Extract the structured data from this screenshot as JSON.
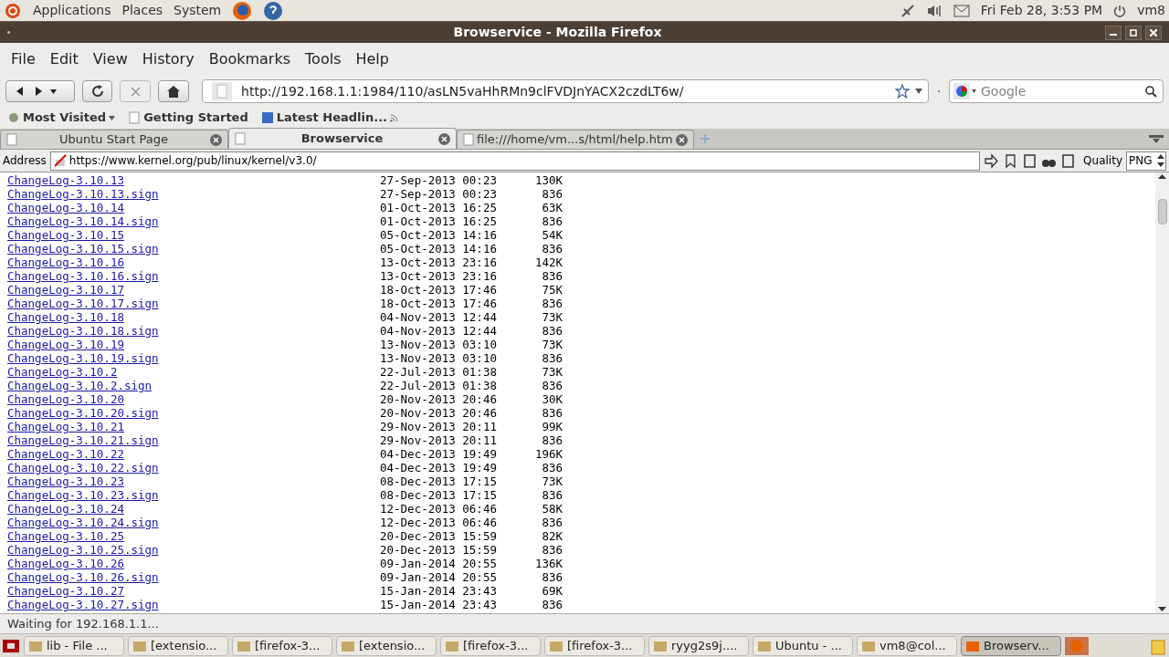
{
  "top_panel": {
    "menus": [
      "Applications",
      "Places",
      "System"
    ],
    "clock": "Fri Feb 28,  3:53 PM",
    "user": "vm8"
  },
  "window": {
    "title": "Browservice - Mozilla Firefox"
  },
  "menu_bar": [
    "File",
    "Edit",
    "View",
    "History",
    "Bookmarks",
    "Tools",
    "Help"
  ],
  "url": "http://192.168.1.1:1984/110/asLN5vaHhRMn9clFVDJnYACX2czdLT6w/",
  "search": {
    "placeholder": "Google"
  },
  "bookmarks": [
    "Most Visited",
    "Getting Started",
    "Latest Headlin..."
  ],
  "tabs": [
    {
      "label": "Ubuntu Start Page",
      "selected": false
    },
    {
      "label": "Browservice",
      "selected": true
    },
    {
      "label": "file:///home/vm...s/html/help.htm",
      "selected": false
    }
  ],
  "inner_toolbar": {
    "address_label": "Address",
    "address": "https://www.kernel.org/pub/linux/kernel/v3.0/",
    "quality_label": "Quality",
    "quality": "PNG"
  },
  "listing": [
    [
      "ChangeLog-3.10.13",
      "27-Sep-2013 00:23",
      "130K"
    ],
    [
      "ChangeLog-3.10.13.sign",
      "27-Sep-2013 00:23",
      "836"
    ],
    [
      "ChangeLog-3.10.14",
      "01-Oct-2013 16:25",
      "63K"
    ],
    [
      "ChangeLog-3.10.14.sign",
      "01-Oct-2013 16:25",
      "836"
    ],
    [
      "ChangeLog-3.10.15",
      "05-Oct-2013 14:16",
      "54K"
    ],
    [
      "ChangeLog-3.10.15.sign",
      "05-Oct-2013 14:16",
      "836"
    ],
    [
      "ChangeLog-3.10.16",
      "13-Oct-2013 23:16",
      "142K"
    ],
    [
      "ChangeLog-3.10.16.sign",
      "13-Oct-2013 23:16",
      "836"
    ],
    [
      "ChangeLog-3.10.17",
      "18-Oct-2013 17:46",
      "75K"
    ],
    [
      "ChangeLog-3.10.17.sign",
      "18-Oct-2013 17:46",
      "836"
    ],
    [
      "ChangeLog-3.10.18",
      "04-Nov-2013 12:44",
      "73K"
    ],
    [
      "ChangeLog-3.10.18.sign",
      "04-Nov-2013 12:44",
      "836"
    ],
    [
      "ChangeLog-3.10.19",
      "13-Nov-2013 03:10",
      "73K"
    ],
    [
      "ChangeLog-3.10.19.sign",
      "13-Nov-2013 03:10",
      "836"
    ],
    [
      "ChangeLog-3.10.2",
      "22-Jul-2013 01:38",
      "73K"
    ],
    [
      "ChangeLog-3.10.2.sign",
      "22-Jul-2013 01:38",
      "836"
    ],
    [
      "ChangeLog-3.10.20",
      "20-Nov-2013 20:46",
      "30K"
    ],
    [
      "ChangeLog-3.10.20.sign",
      "20-Nov-2013 20:46",
      "836"
    ],
    [
      "ChangeLog-3.10.21",
      "29-Nov-2013 20:11",
      "99K"
    ],
    [
      "ChangeLog-3.10.21.sign",
      "29-Nov-2013 20:11",
      "836"
    ],
    [
      "ChangeLog-3.10.22",
      "04-Dec-2013 19:49",
      "196K"
    ],
    [
      "ChangeLog-3.10.22.sign",
      "04-Dec-2013 19:49",
      "836"
    ],
    [
      "ChangeLog-3.10.23",
      "08-Dec-2013 17:15",
      "73K"
    ],
    [
      "ChangeLog-3.10.23.sign",
      "08-Dec-2013 17:15",
      "836"
    ],
    [
      "ChangeLog-3.10.24",
      "12-Dec-2013 06:46",
      "58K"
    ],
    [
      "ChangeLog-3.10.24.sign",
      "12-Dec-2013 06:46",
      "836"
    ],
    [
      "ChangeLog-3.10.25",
      "20-Dec-2013 15:59",
      "82K"
    ],
    [
      "ChangeLog-3.10.25.sign",
      "20-Dec-2013 15:59",
      "836"
    ],
    [
      "ChangeLog-3.10.26",
      "09-Jan-2014 20:55",
      "136K"
    ],
    [
      "ChangeLog-3.10.26.sign",
      "09-Jan-2014 20:55",
      "836"
    ],
    [
      "ChangeLog-3.10.27",
      "15-Jan-2014 23:43",
      "69K"
    ],
    [
      "ChangeLog-3.10.27.sign",
      "15-Jan-2014 23:43",
      "836"
    ]
  ],
  "status_bar": "Waiting for 192.168.1.1...",
  "taskbar": [
    {
      "label": "lib - File ...",
      "selected": false
    },
    {
      "label": "[extensio...",
      "selected": false
    },
    {
      "label": "[firefox-3...",
      "selected": false
    },
    {
      "label": "[extensio...",
      "selected": false
    },
    {
      "label": "[firefox-3...",
      "selected": false
    },
    {
      "label": "[firefox-3...",
      "selected": false
    },
    {
      "label": "ryyg2s9j....",
      "selected": false
    },
    {
      "label": "Ubuntu - ...",
      "selected": false
    },
    {
      "label": "vm8@col...",
      "selected": false
    },
    {
      "label": "Browserv...",
      "selected": true
    }
  ]
}
